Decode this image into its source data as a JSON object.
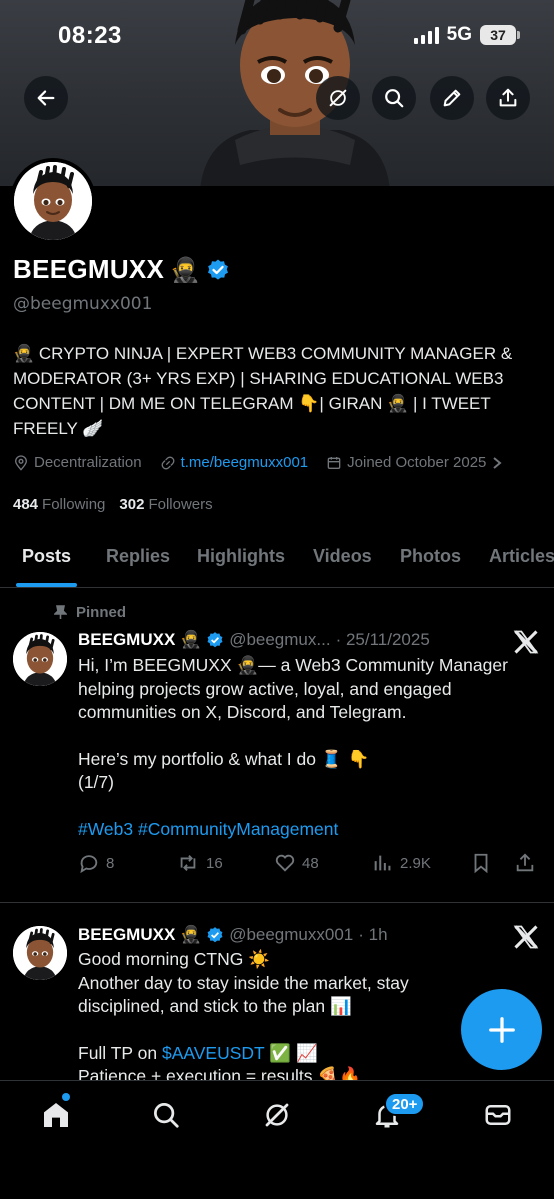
{
  "status_bar": {
    "time": "08:23",
    "network": "5G",
    "battery": "37"
  },
  "profile": {
    "display_name": "BEEGMUXX",
    "name_emoji": "🥷",
    "handle": "@beegmuxx001",
    "bio": "🥷 CRYPTO NINJA | EXPERT WEB3 COMMUNITY MANAGER & MODERATOR (3+ YRS EXP) | SHARING EDUCATIONAL WEB3 CONTENT | DM ME ON TELEGRAM 👇| GIRAN 🥷 | I TWEET FREELY 🪽",
    "location": "Decentralization",
    "website": "t.me/beegmuxx001",
    "joined": "Joined October 2025",
    "following_count": "484",
    "following_label": "Following",
    "followers_count": "302",
    "followers_label": "Followers"
  },
  "tabs": [
    "Posts",
    "Replies",
    "Highlights",
    "Videos",
    "Photos",
    "Articles"
  ],
  "posts": [
    {
      "pinned_label": "Pinned",
      "name": "BEEGMUXX 🥷",
      "handle": "@beegmux...",
      "time": "· 25/11/2025",
      "line1": "Hi, I’m BEEGMUXX 🥷— a Web3 Community Manager",
      "line2": "helping projects grow active, loyal, and engaged",
      "line3": "communities on X, Discord, and Telegram.",
      "line4": "Here’s my portfolio & what I do 🧵 👇",
      "line5": "(1/7)",
      "hashtag1": "#Web3",
      "hashtag2": "#CommunityManagement",
      "replies": "8",
      "reposts": "16",
      "likes": "48",
      "views": "2.9K"
    },
    {
      "name": "BEEGMUXX 🥷",
      "handle": "@beegmuxx001",
      "time": "· 1h",
      "line1": "Good morning CTNG ☀️",
      "line2": "Another day to stay inside the market, stay",
      "line3": "disciplined, and stick to the plan 📊",
      "line4_prefix": "Full TP on ",
      "cashtag": "$AAVEUSDT",
      "line4_suffix": " ✅ 📈",
      "line5": "Patience + execution = results 🍕🔥"
    }
  ],
  "notifications_badge": "20+",
  "colors": {
    "accent": "#1d9bf0",
    "background": "#000000",
    "muted": "#71767b"
  }
}
